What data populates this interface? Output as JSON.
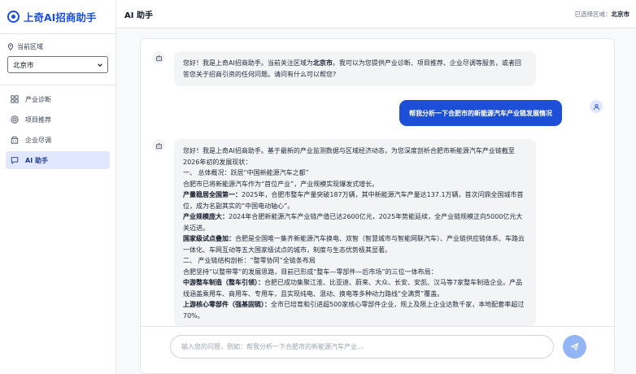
{
  "app": {
    "title": "上奇AI招商助手",
    "brand_color": "#1d4ed8"
  },
  "sidebar": {
    "region_label": "当前区域",
    "region_value": "北京市",
    "items": [
      {
        "label": "产业诊断",
        "icon": "grid-icon"
      },
      {
        "label": "项目推荐",
        "icon": "target-icon"
      },
      {
        "label": "企业尽调",
        "icon": "building-icon"
      },
      {
        "label": "AI 助手",
        "icon": "chat-icon",
        "active": true
      }
    ]
  },
  "header": {
    "title": "AI 助手",
    "selected_label": "已选择区域：",
    "selected_value": "北京市"
  },
  "chat": {
    "greeting": {
      "pre": "您好！我是上奇AI招商助手。当前关注区域为",
      "region": "北京市",
      "post": "。我可以为您提供产业诊断、项目推荐、企业尽调等服务，或者回答您关于招商引资的任何问题。请问有什么可以帮您?"
    },
    "user_message": "帮我分析一下合肥市的新能源汽车产业链发展情况",
    "answer": {
      "intro": "您好！我是上奇AI招商助手。基于最新的产业监测数据与区域经济动态，为您深度剖析合肥市新能源汽车产业链截至2026年初的发展现状：",
      "s1_title": "一、 总体概况：跃居“中国新能源汽车之都”",
      "s1_text": "合肥市已将新能源汽车作为“首位产业”，产业规模实现爆发式增长。",
      "p1_label": "产量稳居全国第一：",
      "p1_text": "2025年，合肥市整车产量突破187万辆，其中新能源汽车产量达137.1万辆，首次问鼎全国城市首位，成为名副其实的“中国电动轴心”。",
      "p2_label": "产业规模庞大：",
      "p2_text": "2024年合肥新能源汽车产业链产值已达2600亿元，2025年势能延续，全产业链规模正向5000亿元大关迈进。",
      "p3_label": "国家级试点叠加：",
      "p3_text": "合肥是全国唯一集齐新能源汽车换电、双智（智慧城市与智能网联汽车）、产业链供应链体系、车路云一体化、车网互动等五大国家级试点的城市，制度与生态优势极其显著。",
      "s2_title": "二、 产业链结构剖析：“整零协同”全链条布局",
      "s2_text": "合肥坚持“以整带零”的发展思路，目前已形成“整车—零部件—后市场”的三位一体布局：",
      "p4_label": "中游整车制造（整车引领）：",
      "p4_text": "合肥已成功集聚江淮、比亚迪、蔚来、大众、长安、安凯、汉马等7家整车制造企业。产品线涵盖乘用车、商用车、专用车，且实现纯电、混动、换电等多种动力路线“全满贯”覆盖。",
      "p5_label": "上游核心零部件（强基固链）：",
      "p5_text": "全市已培育和引进超500家核心零部件企业，规上及限上企业达数千家，本地配套率超过70%。"
    },
    "input_placeholder": "输入您的问题，例如：帮我分析一下合肥市的新能源汽车产业..."
  }
}
